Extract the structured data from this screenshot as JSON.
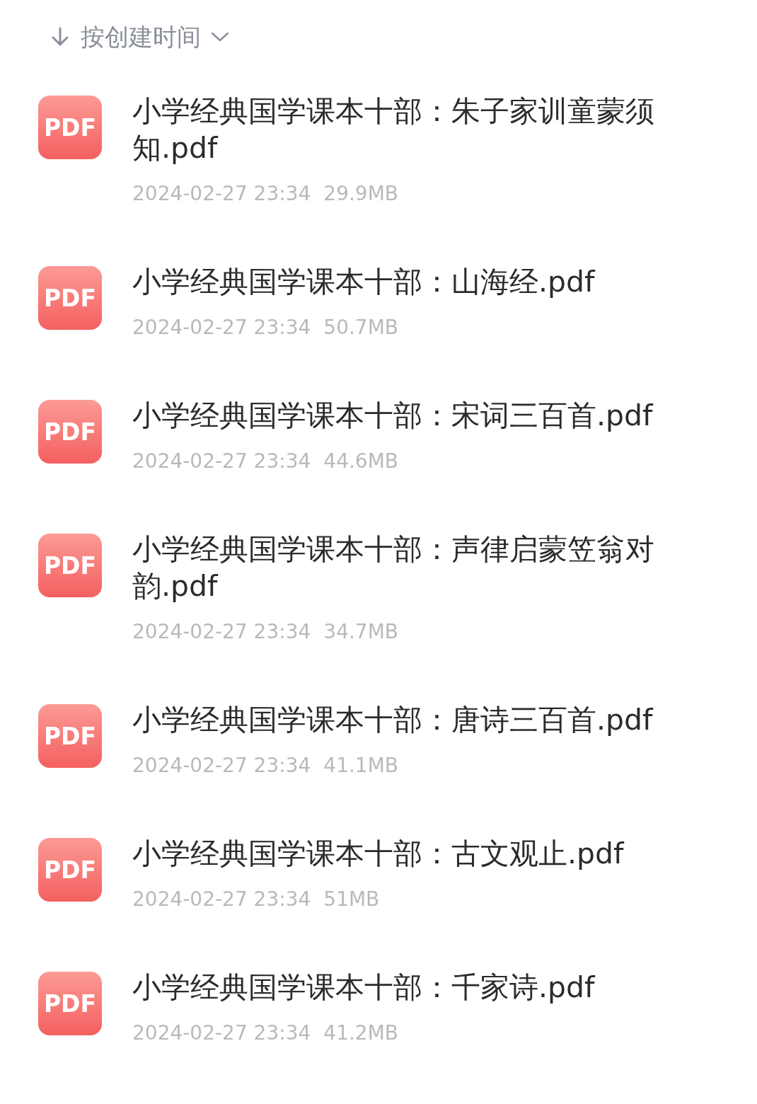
{
  "sort": {
    "label": "按创建时间"
  },
  "files": [
    {
      "badge": "PDF",
      "name": "小学经典国学课本十部：朱子家训童蒙须知.pdf",
      "date": "2024-02-27 23:34",
      "size": "29.9MB"
    },
    {
      "badge": "PDF",
      "name": "小学经典国学课本十部：山海经.pdf",
      "date": "2024-02-27 23:34",
      "size": "50.7MB"
    },
    {
      "badge": "PDF",
      "name": "小学经典国学课本十部：宋词三百首.pdf",
      "date": "2024-02-27 23:34",
      "size": "44.6MB"
    },
    {
      "badge": "PDF",
      "name": "小学经典国学课本十部：声律启蒙笠翁对韵.pdf",
      "date": "2024-02-27 23:34",
      "size": "34.7MB"
    },
    {
      "badge": "PDF",
      "name": "小学经典国学课本十部：唐诗三百首.pdf",
      "date": "2024-02-27 23:34",
      "size": "41.1MB"
    },
    {
      "badge": "PDF",
      "name": "小学经典国学课本十部：古文观止.pdf",
      "date": "2024-02-27 23:34",
      "size": "51MB"
    },
    {
      "badge": "PDF",
      "name": "小学经典国学课本十部：千家诗.pdf",
      "date": "2024-02-27 23:34",
      "size": "41.2MB"
    }
  ]
}
